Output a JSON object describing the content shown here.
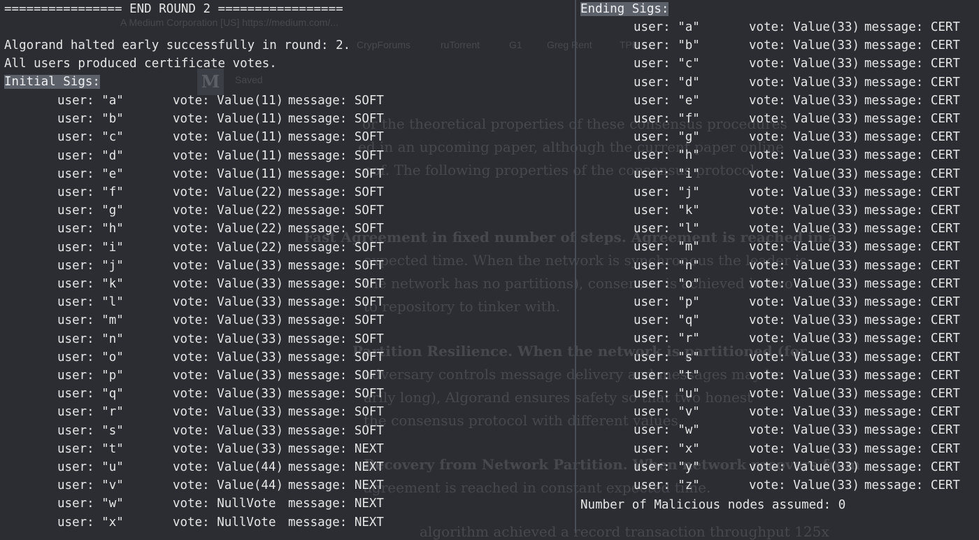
{
  "background_page": {
    "address_bar": "A Medium Corporation [US]   https://medium.com/...",
    "bookmarks": [
      "CrypForums",
      "ruTorrent",
      "G1",
      "Greg Rent",
      "TPB"
    ],
    "logo_letter": "M",
    "nav_item": "Saved",
    "body_lines": [
      "or the theoretical properties of these consensus procedures",
      "ed in an upcoming paper, although the current paper online",
      "oof. The following properties of the consensus protocol:",
      "Fast Agreement in fixed number of steps. Agreement is reached in a",
      "expected time. When the network is synchronous the leader is",
      "the network has no partitions), consensus is achieved in two",
      "to repository to tinker with.",
      "Partition Resilience. When the network is partitioned (for",
      "adversary controls message delivery and messages may be",
      "arily long), Algorand ensures safety so that two honest",
      "the consensus protocol with different values.",
      "Recovery from Network Partition. When network recovers from",
      "agreement is reached in constant expected time.",
      "algorithm achieved a record transaction throughput 125x"
    ]
  },
  "left_pane": {
    "round_banner": "================ END ROUND 2 =================",
    "status_line_1": "Algorand halted early successfully in round: 2.",
    "status_line_2": "All users produced certificate votes.",
    "section_label": "Initial Sigs:",
    "rows": [
      {
        "user": "user: \"a\"",
        "vote": "vote: Value(11)",
        "message": "message: SOFT"
      },
      {
        "user": "user: \"b\"",
        "vote": "vote: Value(11)",
        "message": "message: SOFT"
      },
      {
        "user": "user: \"c\"",
        "vote": "vote: Value(11)",
        "message": "message: SOFT"
      },
      {
        "user": "user: \"d\"",
        "vote": "vote: Value(11)",
        "message": "message: SOFT"
      },
      {
        "user": "user: \"e\"",
        "vote": "vote: Value(11)",
        "message": "message: SOFT"
      },
      {
        "user": "user: \"f\"",
        "vote": "vote: Value(22)",
        "message": "message: SOFT"
      },
      {
        "user": "user: \"g\"",
        "vote": "vote: Value(22)",
        "message": "message: SOFT"
      },
      {
        "user": "user: \"h\"",
        "vote": "vote: Value(22)",
        "message": "message: SOFT"
      },
      {
        "user": "user: \"i\"",
        "vote": "vote: Value(22)",
        "message": "message: SOFT"
      },
      {
        "user": "user: \"j\"",
        "vote": "vote: Value(33)",
        "message": "message: SOFT"
      },
      {
        "user": "user: \"k\"",
        "vote": "vote: Value(33)",
        "message": "message: SOFT"
      },
      {
        "user": "user: \"l\"",
        "vote": "vote: Value(33)",
        "message": "message: SOFT"
      },
      {
        "user": "user: \"m\"",
        "vote": "vote: Value(33)",
        "message": "message: SOFT"
      },
      {
        "user": "user: \"n\"",
        "vote": "vote: Value(33)",
        "message": "message: SOFT"
      },
      {
        "user": "user: \"o\"",
        "vote": "vote: Value(33)",
        "message": "message: SOFT"
      },
      {
        "user": "user: \"p\"",
        "vote": "vote: Value(33)",
        "message": "message: SOFT"
      },
      {
        "user": "user: \"q\"",
        "vote": "vote: Value(33)",
        "message": "message: SOFT"
      },
      {
        "user": "user: \"r\"",
        "vote": "vote: Value(33)",
        "message": "message: SOFT"
      },
      {
        "user": "user: \"s\"",
        "vote": "vote: Value(33)",
        "message": "message: SOFT"
      },
      {
        "user": "user: \"t\"",
        "vote": "vote: Value(33)",
        "message": "message: NEXT"
      },
      {
        "user": "user: \"u\"",
        "vote": "vote: Value(44)",
        "message": "message: NEXT"
      },
      {
        "user": "user: \"v\"",
        "vote": "vote: Value(44)",
        "message": "message: NEXT"
      },
      {
        "user": "user: \"w\"",
        "vote": "vote: NullVote",
        "message": "message: NEXT"
      },
      {
        "user": "user: \"x\"",
        "vote": "vote: NullVote",
        "message": "message: NEXT"
      }
    ]
  },
  "right_pane": {
    "section_label": "Ending Sigs:",
    "rows": [
      {
        "user": "user: \"a\"",
        "vote": "vote: Value(33)",
        "message": "message: CERT"
      },
      {
        "user": "user: \"b\"",
        "vote": "vote: Value(33)",
        "message": "message: CERT"
      },
      {
        "user": "user: \"c\"",
        "vote": "vote: Value(33)",
        "message": "message: CERT"
      },
      {
        "user": "user: \"d\"",
        "vote": "vote: Value(33)",
        "message": "message: CERT"
      },
      {
        "user": "user: \"e\"",
        "vote": "vote: Value(33)",
        "message": "message: CERT"
      },
      {
        "user": "user: \"f\"",
        "vote": "vote: Value(33)",
        "message": "message: CERT"
      },
      {
        "user": "user: \"g\"",
        "vote": "vote: Value(33)",
        "message": "message: CERT"
      },
      {
        "user": "user: \"h\"",
        "vote": "vote: Value(33)",
        "message": "message: CERT"
      },
      {
        "user": "user: \"i\"",
        "vote": "vote: Value(33)",
        "message": "message: CERT"
      },
      {
        "user": "user: \"j\"",
        "vote": "vote: Value(33)",
        "message": "message: CERT"
      },
      {
        "user": "user: \"k\"",
        "vote": "vote: Value(33)",
        "message": "message: CERT"
      },
      {
        "user": "user: \"l\"",
        "vote": "vote: Value(33)",
        "message": "message: CERT"
      },
      {
        "user": "user: \"m\"",
        "vote": "vote: Value(33)",
        "message": "message: CERT"
      },
      {
        "user": "user: \"n\"",
        "vote": "vote: Value(33)",
        "message": "message: CERT"
      },
      {
        "user": "user: \"o\"",
        "vote": "vote: Value(33)",
        "message": "message: CERT"
      },
      {
        "user": "user: \"p\"",
        "vote": "vote: Value(33)",
        "message": "message: CERT"
      },
      {
        "user": "user: \"q\"",
        "vote": "vote: Value(33)",
        "message": "message: CERT"
      },
      {
        "user": "user: \"r\"",
        "vote": "vote: Value(33)",
        "message": "message: CERT"
      },
      {
        "user": "user: \"s\"",
        "vote": "vote: Value(33)",
        "message": "message: CERT"
      },
      {
        "user": "user: \"t\"",
        "vote": "vote: Value(33)",
        "message": "message: CERT"
      },
      {
        "user": "user: \"u\"",
        "vote": "vote: Value(33)",
        "message": "message: CERT"
      },
      {
        "user": "user: \"v\"",
        "vote": "vote: Value(33)",
        "message": "message: CERT"
      },
      {
        "user": "user: \"w\"",
        "vote": "vote: Value(33)",
        "message": "message: CERT"
      },
      {
        "user": "user: \"x\"",
        "vote": "vote: Value(33)",
        "message": "message: CERT"
      },
      {
        "user": "user: \"y\"",
        "vote": "vote: Value(33)",
        "message": "message: CERT"
      },
      {
        "user": "user: \"z\"",
        "vote": "vote: Value(33)",
        "message": "message: CERT"
      }
    ],
    "footer_line": "Number of Malicious nodes assumed: 0"
  }
}
